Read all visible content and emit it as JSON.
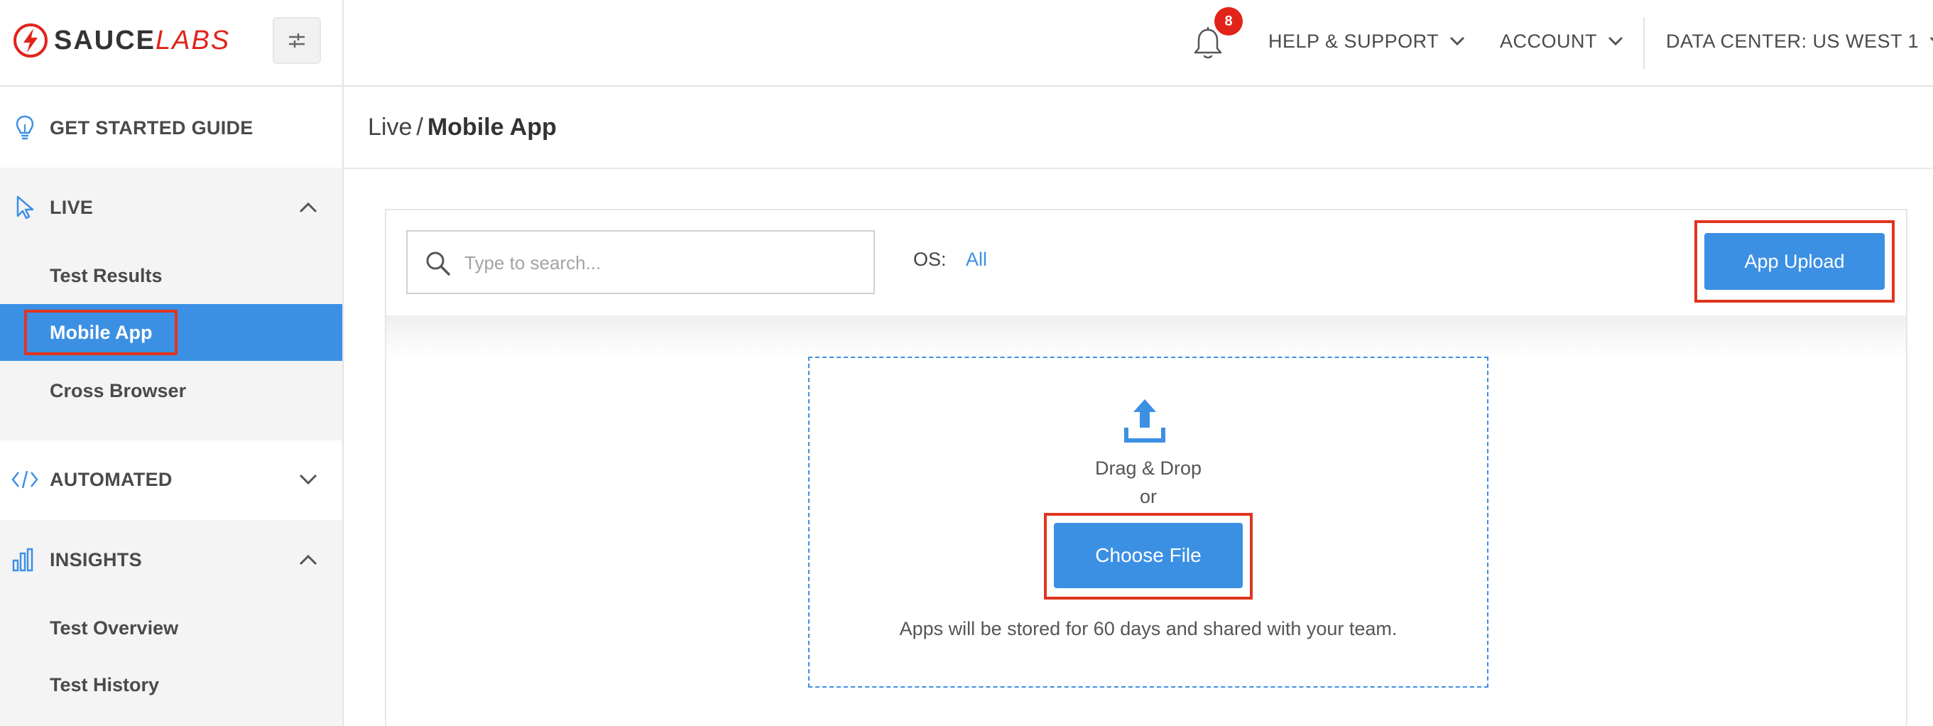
{
  "brand": {
    "part1": "SAUCE",
    "part2": "LABS",
    "accent_color": "#e2231a",
    "primary_color": "#3c90e4",
    "collapse_icon": "collapse-sidebar-icon"
  },
  "sidebar": {
    "get_started": {
      "label": "GET STARTED GUIDE",
      "icon": "lightbulb-icon"
    },
    "live": {
      "label": "LIVE",
      "icon": "cursor-icon",
      "expanded": true,
      "items": [
        {
          "label": "Test Results",
          "active": false
        },
        {
          "label": "Mobile App",
          "active": true
        },
        {
          "label": "Cross Browser",
          "active": false
        }
      ]
    },
    "automated": {
      "label": "AUTOMATED",
      "icon": "code-icon",
      "expanded": false
    },
    "insights": {
      "label": "INSIGHTS",
      "icon": "bar-chart-icon",
      "expanded": true,
      "items": [
        {
          "label": "Test Overview"
        },
        {
          "label": "Test History"
        }
      ]
    }
  },
  "topbar": {
    "notifications_count": "8",
    "help_label": "HELP & SUPPORT",
    "account_label": "ACCOUNT",
    "data_center_label": "DATA CENTER: US WEST 1"
  },
  "breadcrumb": {
    "parent": "Live",
    "separator": "/",
    "current": "Mobile App"
  },
  "toolbar": {
    "search_placeholder": "Type to search...",
    "os_label": "OS:",
    "os_value": "All",
    "upload_label": "App Upload"
  },
  "dropzone": {
    "drag_text": "Drag & Drop",
    "or_text": "or",
    "choose_label": "Choose File",
    "note": "Apps will be stored for 60 days and shared with your team.",
    "icon": "upload-icon"
  }
}
